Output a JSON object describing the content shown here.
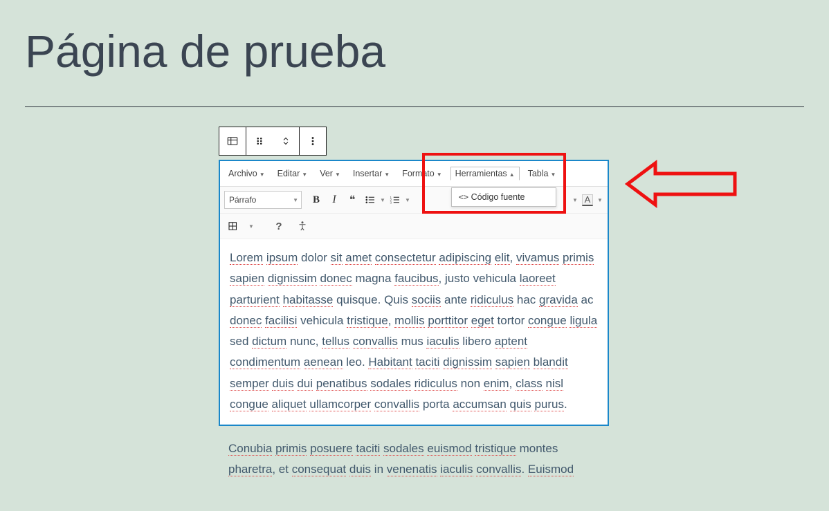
{
  "page_title": "Página de prueba",
  "block_toolbar": {
    "icons": [
      "classic-icon",
      "drag-handle-icon",
      "move-icon",
      "more-options-icon"
    ]
  },
  "menubar": {
    "items": [
      {
        "label": "Archivo",
        "open": false
      },
      {
        "label": "Editar",
        "open": false
      },
      {
        "label": "Ver",
        "open": false
      },
      {
        "label": "Insertar",
        "open": false
      },
      {
        "label": "Formato",
        "open": false
      },
      {
        "label": "Herramientas",
        "open": true
      },
      {
        "label": "Tabla",
        "open": false
      }
    ],
    "dropdown": {
      "parent": "Herramientas",
      "items": [
        {
          "symbol": "<>",
          "label": "Código fuente"
        }
      ]
    }
  },
  "toolbar": {
    "paragraph_selector": "Párrafo",
    "buttons": [
      "bold",
      "italic",
      "blockquote",
      "bullet-list",
      "numbered-list",
      "align-left",
      "text-color"
    ]
  },
  "toolbar_secondary": {
    "buttons": [
      "table-menu",
      "help",
      "accessibility"
    ]
  },
  "body_text": "Lorem ipsum dolor sit amet consectetur adipiscing elit, vivamus primis sapien dignissim donec magna faucibus, justo vehicula laoreet parturient habitasse quisque. Quis sociis ante ridiculus hac gravida ac donec facilisi vehicula tristique, mollis porttitor eget tortor congue ligula sed dictum nunc, tellus convallis mus iaculis libero aptent condimentum aenean leo. Habitant taciti dignissim sapien blandit semper duis dui penatibus sodales ridiculus non enim, class nisl congue aliquet ullamcorper convallis porta accumsan quis purus.",
  "after_text": "Conubia primis posuere taciti sodales euismod tristique montes pharetra, et consequat duis in venenatis iaculis convallis. Euismod",
  "annotation": {
    "highlight_box": "tools-menu-highlight",
    "arrow": "points-to-tools-menu"
  }
}
